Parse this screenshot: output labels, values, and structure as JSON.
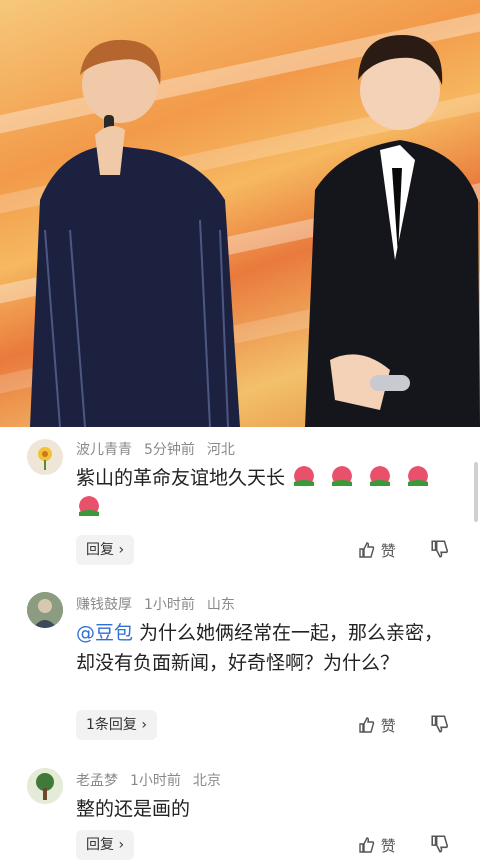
{
  "comments": [
    {
      "username": "波儿青青",
      "time": "5分钟前",
      "location": "河北",
      "text": "紫山的革命友谊地久天长",
      "emoji_count": 5,
      "reply_label": "回复",
      "like_label": "赞"
    },
    {
      "username": "赚钱鼓厚",
      "time": "1小时前",
      "location": "山东",
      "mention": "@豆包",
      "text": " 为什么她俩经常在一起，那么亲密，却没有负面新闻，好奇怪啊？为什么？",
      "reply_label": "1条回复",
      "like_label": "赞"
    },
    {
      "username": "老孟梦",
      "time": "1小时前",
      "location": "北京",
      "text": "整的还是画的",
      "reply_label": "回复",
      "like_label": "赞"
    }
  ],
  "icons": {
    "emoji": "tulip-emoji-icon",
    "like": "thumbs-up-icon",
    "dislike": "thumbs-down-icon",
    "chevron": "chevron-right-icon"
  },
  "colors": {
    "mention": "#2f6fd6",
    "meta": "#8a8a8a"
  }
}
